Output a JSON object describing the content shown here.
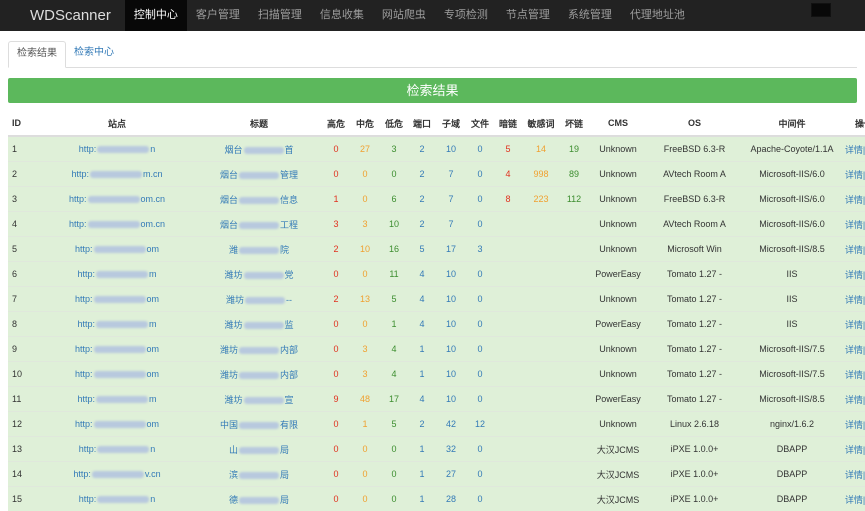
{
  "navbar": {
    "brand": "WDScanner",
    "items": [
      "控制中心",
      "客户管理",
      "扫描管理",
      "信息收集",
      "网站爬虫",
      "专项检测",
      "节点管理",
      "系统管理",
      "代理地址池"
    ]
  },
  "tabs": [
    "检索结果",
    "检索中心"
  ],
  "panel_title": "检索结果",
  "table": {
    "headers": [
      "ID",
      "站点",
      "标题",
      "高危",
      "中危",
      "低危",
      "端口",
      "子域",
      "文件",
      "暗链",
      "敏感词",
      "坏链",
      "CMS",
      "OS",
      "中间件",
      "操作"
    ],
    "rows": [
      {
        "id": "1",
        "site_pre": "http:",
        "site_post": "n",
        "title_pre": "烟台",
        "title_post": "首",
        "high": "0",
        "mid": "27",
        "low": "3",
        "port": "2",
        "sub": "10",
        "file": "0",
        "dark": "5",
        "sens": "14",
        "bad": "19",
        "cms": "Unknown",
        "os": "FreeBSD 6.3-R",
        "mw": "Apache-Coyote/1.1A",
        "action": "详情|删除"
      },
      {
        "id": "2",
        "site_pre": "http:",
        "site_post": "m.cn",
        "title_pre": "烟台",
        "title_post": "管理",
        "high": "0",
        "mid": "0",
        "low": "0",
        "port": "2",
        "sub": "7",
        "file": "0",
        "dark": "4",
        "sens": "998",
        "bad": "89",
        "cms": "Unknown",
        "os": "AVtech Room A",
        "mw": "Microsoft-IIS/6.0",
        "action": "详情|删除"
      },
      {
        "id": "3",
        "site_pre": "http:",
        "site_post": "om.cn",
        "title_pre": "烟台",
        "title_post": "信息",
        "high": "1",
        "mid": "0",
        "low": "6",
        "port": "2",
        "sub": "7",
        "file": "0",
        "dark": "8",
        "sens": "223",
        "bad": "112",
        "cms": "Unknown",
        "os": "FreeBSD 6.3-R",
        "mw": "Microsoft-IIS/6.0",
        "action": "详情|删除"
      },
      {
        "id": "4",
        "site_pre": "http:",
        "site_post": "om.cn",
        "title_pre": "烟台",
        "title_post": "工程",
        "high": "3",
        "mid": "3",
        "low": "10",
        "port": "2",
        "sub": "7",
        "file": "0",
        "dark": "",
        "sens": "",
        "bad": "",
        "cms": "Unknown",
        "os": "AVtech Room A",
        "mw": "Microsoft-IIS/6.0",
        "action": "详情|删除"
      },
      {
        "id": "5",
        "site_pre": "http:",
        "site_post": "om",
        "title_pre": "潍",
        "title_post": "院",
        "high": "2",
        "mid": "10",
        "low": "16",
        "port": "5",
        "sub": "17",
        "file": "3",
        "dark": "",
        "sens": "",
        "bad": "",
        "cms": "Unknown",
        "os": "Microsoft Win",
        "mw": "Microsoft-IIS/8.5",
        "action": "详情|删除"
      },
      {
        "id": "6",
        "site_pre": "http:",
        "site_post": "m",
        "title_pre": "潍坊",
        "title_post": "党",
        "high": "0",
        "mid": "0",
        "low": "11",
        "port": "4",
        "sub": "10",
        "file": "0",
        "dark": "",
        "sens": "",
        "bad": "",
        "cms": "PowerEasy",
        "os": "Tomato 1.27 -",
        "mw": "IIS",
        "action": "详情|删除"
      },
      {
        "id": "7",
        "site_pre": "http:",
        "site_post": "om",
        "title_pre": "潍坊",
        "title_post": "--",
        "high": "2",
        "mid": "13",
        "low": "5",
        "port": "4",
        "sub": "10",
        "file": "0",
        "dark": "",
        "sens": "",
        "bad": "",
        "cms": "Unknown",
        "os": "Tomato 1.27 -",
        "mw": "IIS",
        "action": "详情|删除"
      },
      {
        "id": "8",
        "site_pre": "http:",
        "site_post": "m",
        "title_pre": "潍坊",
        "title_post": "监",
        "high": "0",
        "mid": "0",
        "low": "1",
        "port": "4",
        "sub": "10",
        "file": "0",
        "dark": "",
        "sens": "",
        "bad": "",
        "cms": "PowerEasy",
        "os": "Tomato 1.27 -",
        "mw": "IIS",
        "action": "详情|删除"
      },
      {
        "id": "9",
        "site_pre": "http:",
        "site_post": "om",
        "title_pre": "潍坊",
        "title_post": "内部",
        "high": "0",
        "mid": "3",
        "low": "4",
        "port": "1",
        "sub": "10",
        "file": "0",
        "dark": "",
        "sens": "",
        "bad": "",
        "cms": "Unknown",
        "os": "Tomato 1.27 -",
        "mw": "Microsoft-IIS/7.5",
        "action": "详情|删除"
      },
      {
        "id": "10",
        "site_pre": "http:",
        "site_post": "om",
        "title_pre": "潍坊",
        "title_post": "内部",
        "high": "0",
        "mid": "3",
        "low": "4",
        "port": "1",
        "sub": "10",
        "file": "0",
        "dark": "",
        "sens": "",
        "bad": "",
        "cms": "Unknown",
        "os": "Tomato 1.27 -",
        "mw": "Microsoft-IIS/7.5",
        "action": "详情|删除"
      },
      {
        "id": "11",
        "site_pre": "http:",
        "site_post": "m",
        "title_pre": "潍坊",
        "title_post": "宣",
        "high": "9",
        "mid": "48",
        "low": "17",
        "port": "4",
        "sub": "10",
        "file": "0",
        "dark": "",
        "sens": "",
        "bad": "",
        "cms": "PowerEasy",
        "os": "Tomato 1.27 -",
        "mw": "Microsoft-IIS/8.5",
        "action": "详情|删除"
      },
      {
        "id": "12",
        "site_pre": "http:",
        "site_post": "om",
        "title_pre": "中国",
        "title_post": "有限",
        "high": "0",
        "mid": "1",
        "low": "5",
        "port": "2",
        "sub": "42",
        "file": "12",
        "dark": "",
        "sens": "",
        "bad": "",
        "cms": "Unknown",
        "os": "Linux 2.6.18",
        "mw": "nginx/1.6.2",
        "action": "详情|删除"
      },
      {
        "id": "13",
        "site_pre": "http:",
        "site_post": "n",
        "title_pre": "山",
        "title_post": "局",
        "high": "0",
        "mid": "0",
        "low": "0",
        "port": "1",
        "sub": "32",
        "file": "0",
        "dark": "",
        "sens": "",
        "bad": "",
        "cms": "大汉JCMS",
        "os": "iPXE 1.0.0+",
        "mw": "DBAPP",
        "action": "详情|删除"
      },
      {
        "id": "14",
        "site_pre": "http:",
        "site_post": "v.cn",
        "title_pre": "滨",
        "title_post": "局",
        "high": "0",
        "mid": "0",
        "low": "0",
        "port": "1",
        "sub": "27",
        "file": "0",
        "dark": "",
        "sens": "",
        "bad": "",
        "cms": "大汉JCMS",
        "os": "iPXE 1.0.0+",
        "mw": "DBAPP",
        "action": "详情|删除"
      },
      {
        "id": "15",
        "site_pre": "http:",
        "site_post": "n",
        "title_pre": "德",
        "title_post": "局",
        "high": "0",
        "mid": "0",
        "low": "0",
        "port": "1",
        "sub": "28",
        "file": "0",
        "dark": "",
        "sens": "",
        "bad": "",
        "cms": "大汉JCMS",
        "os": "iPXE 1.0.0+",
        "mw": "DBAPP",
        "action": "详情|删除"
      }
    ]
  }
}
